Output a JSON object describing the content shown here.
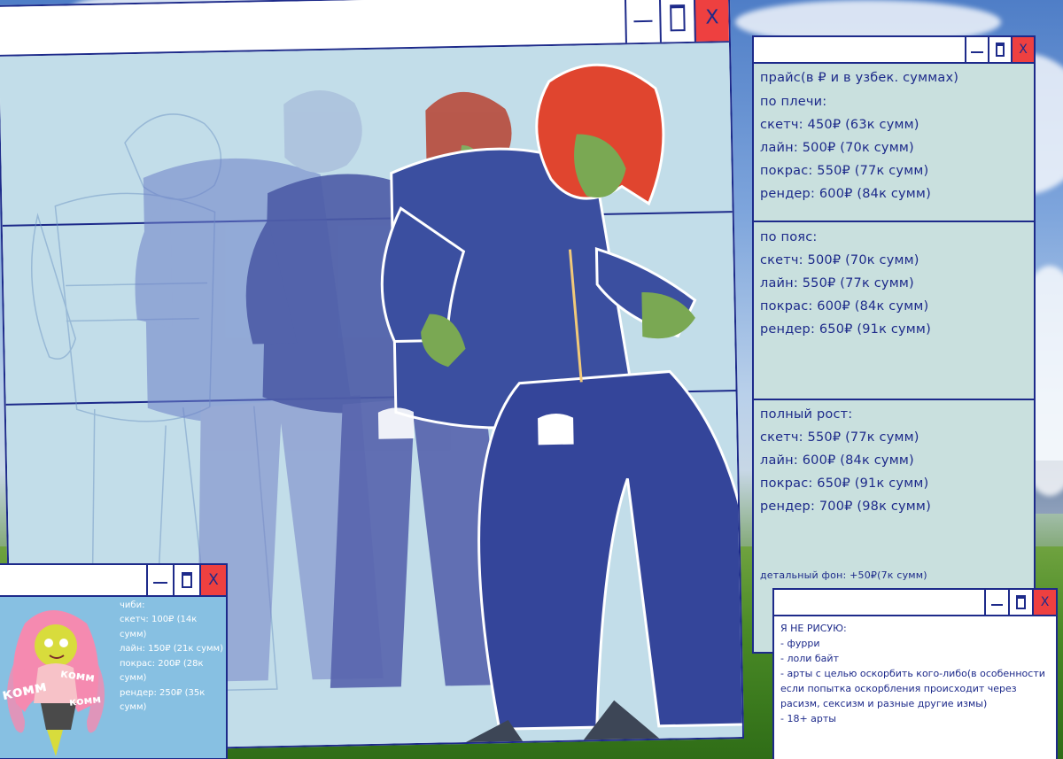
{
  "colors": {
    "frame": "#1d2a8a",
    "close_button": "#ee4040",
    "main_panel": "#c2dde9",
    "price_panel": "#c9e0de",
    "chibi_panel": "#87c0e2",
    "hoodie": "#3b4fa0",
    "hair": "#e0452f",
    "skin": "#7aa853"
  },
  "main_window": {
    "icons": [
      "minimize-icon",
      "maximize-icon",
      "close-icon"
    ],
    "close_glyph": "X"
  },
  "price_window": {
    "title": "прайс(в ₽ и в узбек. суммах)",
    "shoulders": {
      "heading": "по плечи:",
      "rows": [
        "скетч: 450₽ (63к сумм)",
        "лайн: 500₽ (70к сумм)",
        "покрас: 550₽ (77к сумм)",
        "рендер: 600₽ (84к сумм)"
      ]
    },
    "waist": {
      "heading": "по пояс:",
      "rows": [
        "скетч: 500₽ (70к сумм)",
        "лайн: 550₽ (77к сумм)",
        "покрас: 600₽ (84к сумм)",
        "рендер: 650₽ (91к сумм)"
      ]
    },
    "full": {
      "heading": "полный рост:",
      "rows": [
        "скетч: 550₽ (77к сумм)",
        "лайн: 600₽ (84к сумм)",
        "покрас: 650₽ (91к сумм)",
        "рендер: 700₽ (98к сумм)"
      ]
    },
    "background_note": "детальный фон: +50₽(7к сумм)"
  },
  "chibi_window": {
    "lines": [
      "чиби:",
      "скетч: 100₽ (14к",
      "сумм)",
      "лайн: 150₽ (21к сумм)",
      "покрас: 200₽ (28к",
      "сумм)",
      "рендер: 250₽ (35к",
      "сумм)"
    ],
    "watermark": [
      "комм",
      "комм",
      "комм"
    ]
  },
  "nodraw_window": {
    "lines": [
      "Я НЕ РИСУЮ:",
      "- фурри",
      "- лоли байт",
      "- арты с целью оскорбить кого-либо(в особенности",
      "если попытка оскорбления происходит через",
      "расизм, сексизм и разные другие измы)",
      "- 18+ арты"
    ]
  }
}
